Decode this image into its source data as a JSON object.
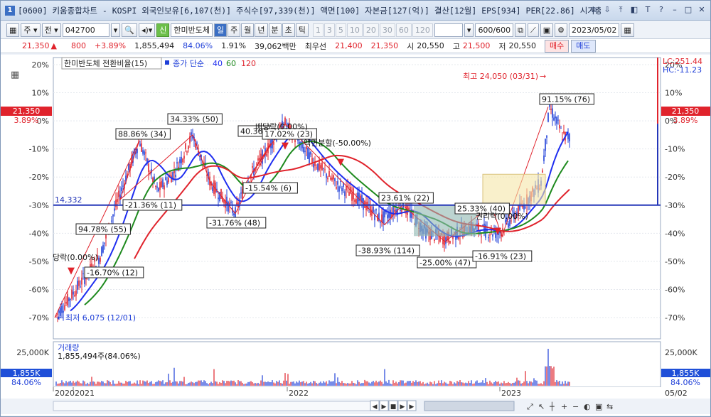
{
  "titlebar": {
    "num": "1",
    "text": "[0600] 키움종합차트 - KOSPI 외국인보유[6,107(천)] 주식수[97,339(천)] 액면[100] 자본금[127(억)] 결산[12월] EPS[934] PER[22.86] 시가총액",
    "buttons": [
      "⧉",
      "⇩",
      "⤒",
      "◧",
      "T",
      "?",
      "–",
      "□",
      "✕"
    ]
  },
  "toolbar": {
    "market": "주",
    "type": "전",
    "code": "042700",
    "stock_badge": "신",
    "stock_name": "한미반도체",
    "periods": [
      "일",
      "주",
      "월",
      "년",
      "분",
      "초",
      "틱"
    ],
    "intervals": [
      "1",
      "3",
      "5",
      "10",
      "20",
      "30",
      "60",
      "120"
    ],
    "count": "600/600",
    "date": "2023/05/02"
  },
  "infobar": {
    "price": "21,350",
    "arrow": "▲",
    "change": "800",
    "pct": "+3.89%",
    "volume": "1,855,494",
    "vol_ratio": "84.06%",
    "turnover": "1.91%",
    "amount": "39,062백만",
    "best_label": "최우선",
    "best_ask": "21,400",
    "best_bid": "21,350",
    "open_label": "시",
    "open": "20,550",
    "high_label": "고",
    "high": "21,500",
    "low_label": "저",
    "low": "20,550",
    "buy": "매수",
    "sell": "매도"
  },
  "chart": {
    "legend_name": "한미반도체 전환비율(15)",
    "legend_ma": "종가 단순",
    "ma1": "40",
    "ma2": "60",
    "ma3": "120",
    "lc": "LC:251.44",
    "hc": "HC:-11.23",
    "right_price": "21,350",
    "right_pct": "3.89%",
    "left_price": "21,350",
    "left_pct": "3.89%",
    "hline_value": "14,332",
    "y_ticks": [
      "20%",
      "10%",
      "0%",
      "-10%",
      "-20%",
      "-30%",
      "-40%",
      "-50%",
      "-60%",
      "-70%"
    ],
    "annotations": {
      "max": "최고 24,050 (03/31)",
      "min": "최저 6,075 (12/01)",
      "a1": "88.86% (34)",
      "a2": "34.33% (50)",
      "a3": "40.36%",
      "a4": "17.02% (23)",
      "a5": "94.78% (55)",
      "a6": "-21.36% (11)",
      "a7": "-15.54% (6)",
      "a8": "-31.76% (48)",
      "a9": "-16.70% (12)",
      "a10": "23.61% (22)",
      "a11": "-38.93% (114)",
      "a12": "-25.00% (47)",
      "a13": "25.33% (40)",
      "a14": "-16.91% (23)",
      "a15": "91.15% (76)",
      "e1": "당락(0.00%)",
      "e2": "배당락(0.00%)",
      "e3": "액면분할(-50.00%)",
      "e4": "권리락(0.00%)"
    },
    "vol_label": "거래량",
    "vol_value": "1,855,494주(84.06%)",
    "vol_tick": "25,000K",
    "vol_right": "1,855K",
    "vol_right_pct": "84.06%",
    "x_ticks": [
      "2020",
      "2021",
      "2022",
      "2023"
    ],
    "x_right": "05/02"
  },
  "colors": {
    "ma40": "#1f2ef0",
    "ma60": "#1e8a1e",
    "ma120": "#e0232c",
    "hline": "#2436b8"
  }
}
